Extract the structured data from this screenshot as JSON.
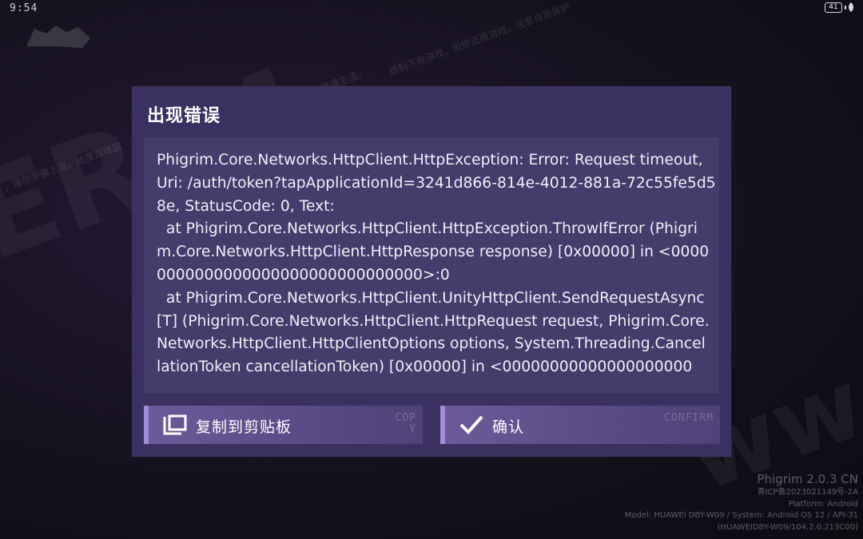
{
  "status_bar": {
    "time": "9:54",
    "battery_level": "41"
  },
  "background": {
    "warning_text_1": "抵制不良游戏，拒绝盗版游戏。注意自我保护",
    "warning_text_2": "健康生活。",
    "warning_text_3": "，谨防受骗上当。适度游戏益"
  },
  "dialog": {
    "title": "出现错误",
    "error_lines": [
      "Phigrim.Core.Networks.HttpClient.HttpException: Error: Request timeout,",
      "Uri: /auth/token?tapApplicationId=3241d866-814e-4012-881a-72c55fe5d5",
      "8e, StatusCode: 0, Text:",
      "  at Phigrim.Core.Networks.HttpClient.HttpException.ThrowIfError (Phigri",
      "m.Core.Networks.HttpClient.HttpResponse response) [0x00000] in <0000",
      "0000000000000000000000000000>:0",
      "  at Phigrim.Core.Networks.HttpClient.UnityHttpClient.SendRequestAsync",
      "[T] (Phigrim.Core.Networks.HttpClient.HttpRequest request, Phigrim.Core.",
      "Networks.HttpClient.HttpClientOptions options, System.Threading.Cancel",
      "lationToken cancellationToken) [0x00000] in <00000000000000000000"
    ],
    "copy_button": {
      "label": "复制到剪贴板",
      "deco": "COPY",
      "icon": "copy-icon"
    },
    "confirm_button": {
      "label": "确认",
      "deco": "CONFIRM",
      "icon": "checkmark-icon"
    }
  },
  "footer": {
    "version": "Phigrim 2.0.3 CN",
    "icp": "青ICP备2023021149号-2A",
    "platform": "Platform: Android",
    "model": "Model: HUAWEI DBY-W09 / System: Android OS 12 / API-31",
    "build": "(HUAWEIDBY-W09/104.2.0.213C00)"
  },
  "colors": {
    "dialog_bg": "#3a3160",
    "error_box_bg": "#453c6c",
    "button_accent": "#a48bd8"
  }
}
